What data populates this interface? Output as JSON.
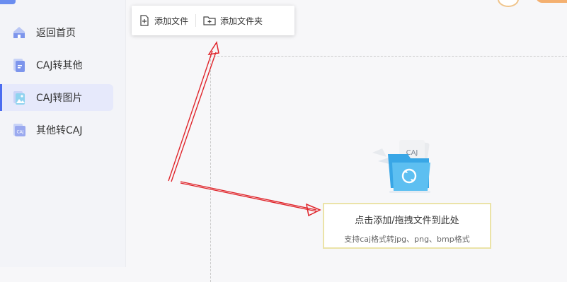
{
  "sidebar": {
    "items": [
      {
        "label": "返回首页",
        "icon": "home-icon"
      },
      {
        "label": "CAJ转其他",
        "icon": "document-convert-icon"
      },
      {
        "label": "CAJ转图片",
        "icon": "image-icon"
      },
      {
        "label": "其他转CAJ",
        "icon": "caj-file-icon"
      }
    ],
    "active_index": 2
  },
  "toolbar": {
    "add_file_label": "添加文件",
    "add_folder_label": "添加文件夹"
  },
  "dropzone": {
    "illustration_text": "CAJ",
    "prompt_main": "点击添加/拖拽文件到此处",
    "prompt_sub": "支持caj格式转jpg、png、bmp格式"
  },
  "colors": {
    "accent": "#4b6cf0",
    "active_bg": "#e6e9fb",
    "annotation_arrow": "#e0252b",
    "prompt_border": "#ebe3a8"
  }
}
